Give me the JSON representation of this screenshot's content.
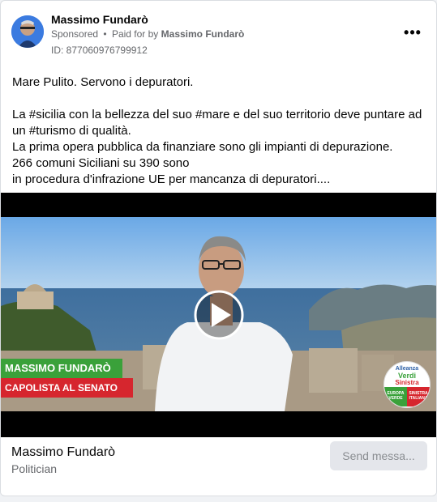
{
  "post": {
    "page_name": "Massimo Fundarò",
    "sponsored_label": "Sponsored",
    "separator": "•",
    "paid_for_prefix": "Paid for by",
    "paid_for_name": "Massimo Fundarò",
    "ad_id": "ID: 877060976799912",
    "more_icon": "more-options-icon",
    "text_lines": {
      "l1": "Mare Pulito. Servono i depuratori.",
      "l2": "La #sicilia con la bellezza del suo #mare e del suo territorio deve puntare ad un #turismo di qualità.",
      "l3": "La prima opera pubblica da finanziare sono gli impianti di depurazione.",
      "l4": "266 comuni Siciliani su 390 sono",
      "l5": "in procedura d'infrazione UE per mancanza di depuratori...."
    }
  },
  "video": {
    "overlay_name": "MASSIMO FUNDARÒ",
    "overlay_role": "CAPOLISTA AL SENATO",
    "logo_top": "Alleanza",
    "logo_mid": "Verdi",
    "logo_bottom": "Sinistra",
    "logo_left": "EUROPA VERDE",
    "logo_right": "SINISTRA ITALIANA",
    "play_icon": "play-icon",
    "colors": {
      "green": "#3aa13a",
      "red": "#d6262e"
    }
  },
  "footer": {
    "name": "Massimo Fundarò",
    "category": "Politician",
    "button_label": "Send messa..."
  }
}
